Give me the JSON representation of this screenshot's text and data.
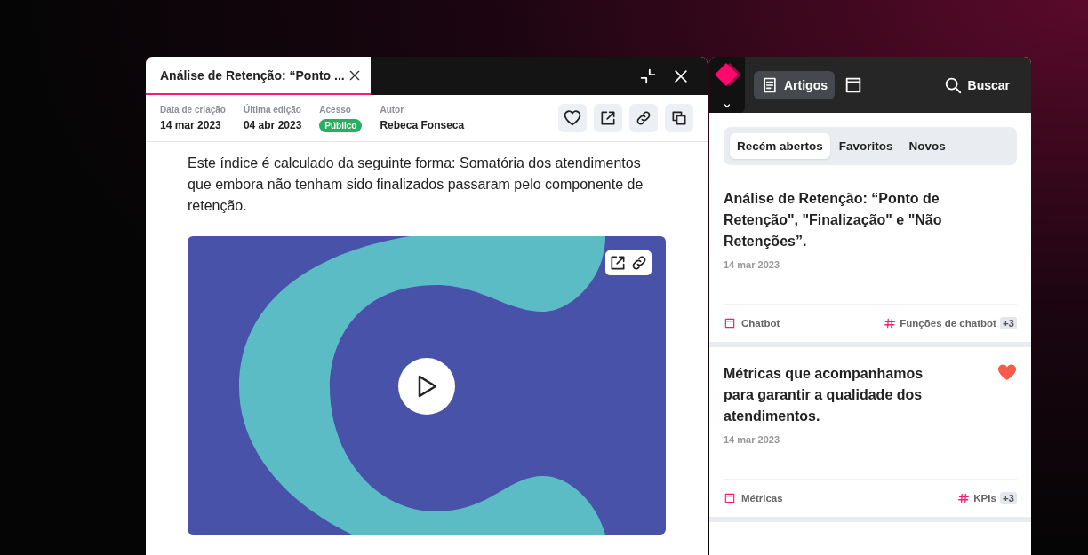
{
  "article_window": {
    "tab_title": "Análise de Retenção: “Ponto ...",
    "meta": [
      {
        "label": "Data de criação",
        "value": "14 mar 2023",
        "kind": "text"
      },
      {
        "label": "Última edição",
        "value": "04 abr 2023",
        "kind": "text"
      },
      {
        "label": "Acesso",
        "value": "Público",
        "kind": "badge"
      },
      {
        "label": "Autor",
        "value": "Rebeca Fonseca",
        "kind": "text"
      }
    ],
    "body": "Este índice é calculado da seguinte forma: Somatória dos atendimentos que embora não tenham sido finalizados passaram pelo componente de retenção."
  },
  "sidebar": {
    "nav_label": "Artigos",
    "search_label": "Buscar",
    "tabs": [
      {
        "label": "Recém abertos",
        "selected": true
      },
      {
        "label": "Favoritos",
        "selected": false
      },
      {
        "label": "Novos",
        "selected": false
      }
    ],
    "cards": [
      {
        "title": "Análise de Retenção: “Ponto de Retenção\", \"Finalização\" e \"Não Retenções”.",
        "date": "14 mar 2023",
        "favorite": false,
        "category": "Chatbot",
        "tag": "Funções de chatbot",
        "more": "+3"
      },
      {
        "title": "Métricas que acompanhamos para garantir a qualidade dos atendimentos.",
        "date": "14 mar 2023",
        "favorite": true,
        "category": "Métricas",
        "tag": "KPIs",
        "more": "+3"
      }
    ]
  }
}
